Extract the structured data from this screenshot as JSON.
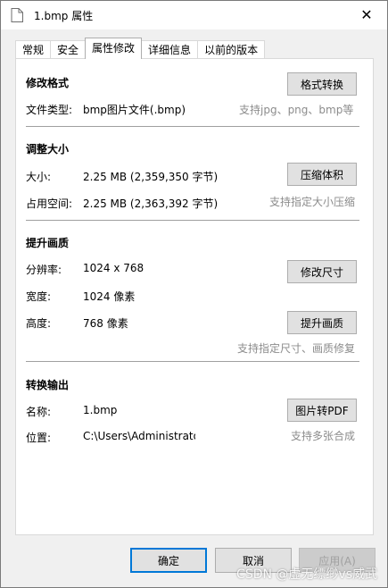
{
  "window": {
    "title": "1.bmp 属性",
    "close_glyph": "✕"
  },
  "tabs": [
    {
      "label": "常规"
    },
    {
      "label": "安全"
    },
    {
      "label": "属性修改",
      "active": true
    },
    {
      "label": "详细信息"
    },
    {
      "label": "以前的版本"
    }
  ],
  "format": {
    "heading": "修改格式",
    "type_label": "文件类型:",
    "type_value": "bmp图片文件(.bmp)",
    "convert_button": "格式转换",
    "hint": "支持jpg、png、bmp等"
  },
  "resize": {
    "heading": "调整大小",
    "size_label": "大小:",
    "size_value": "2.25 MB (2,359,350 字节)",
    "compress_button": "压缩体积",
    "disk_label": "占用空间:",
    "disk_value": "2.25 MB (2,363,392 字节)",
    "hint": "支持指定大小压缩"
  },
  "quality": {
    "heading": "提升画质",
    "resolution_label": "分辨率:",
    "resolution_value": "1024 x 768",
    "resize_button": "修改尺寸",
    "width_label": "宽度:",
    "width_value": "1024 像素",
    "height_label": "高度:",
    "height_value": "768 像素",
    "enhance_button": "提升画质",
    "hint": "支持指定尺寸、画质修复"
  },
  "output": {
    "heading": "转换输出",
    "name_label": "名称:",
    "name_value": "1.bmp",
    "pdf_button": "图片转PDF",
    "location_label": "位置:",
    "location_value": "C:\\Users\\Administrato",
    "hint": "支持多张合成"
  },
  "footer": {
    "ok": "确定",
    "cancel": "取消",
    "apply": "应用(A)"
  },
  "watermark": "CSDN @虚无缥缈vs威武",
  "colors": {
    "accent": "#0078d7",
    "hint": "#8c8c8c"
  }
}
